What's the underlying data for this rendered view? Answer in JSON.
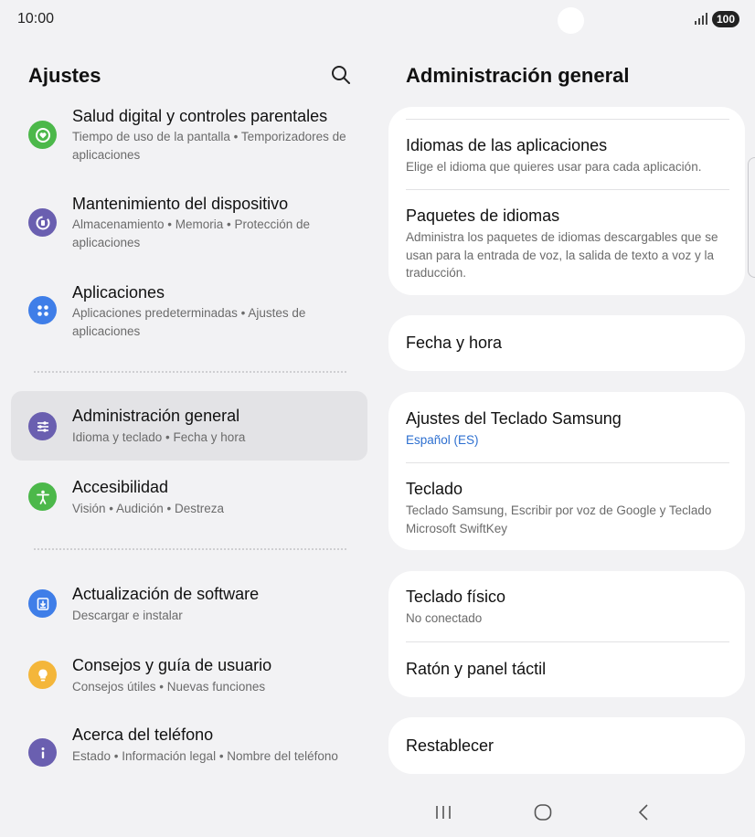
{
  "status_bar": {
    "time": "10:00",
    "battery": "100"
  },
  "left": {
    "title": "Ajustes",
    "items": [
      {
        "title": "Salud digital y controles parentales",
        "subtitle": "Tiempo de uso de la pantalla  •  Temporizadores de aplicaciones",
        "icon": "heart-icon",
        "color": "#4cb84a"
      },
      {
        "title": "Mantenimiento del dispositivo",
        "subtitle": "Almacenamiento  •  Memoria  •  Protección de aplicaciones",
        "icon": "device-care-icon",
        "color": "#6a5fb0"
      },
      {
        "title": "Aplicaciones",
        "subtitle": "Aplicaciones predeterminadas  •  Ajustes de aplicaciones",
        "icon": "apps-icon",
        "color": "#3f7ee8"
      },
      {
        "title": "Administración general",
        "subtitle": "Idioma y teclado  •  Fecha y hora",
        "icon": "sliders-icon",
        "color": "#6a5fb0"
      },
      {
        "title": "Accesibilidad",
        "subtitle": "Visión  •  Audición  •  Destreza",
        "icon": "accessibility-icon",
        "color": "#4cb84a"
      },
      {
        "title": "Actualización de software",
        "subtitle": "Descargar e instalar",
        "icon": "download-icon",
        "color": "#3f7ee8"
      },
      {
        "title": "Consejos y guía de usuario",
        "subtitle": "Consejos útiles  •  Nuevas funciones",
        "icon": "lightbulb-icon",
        "color": "#f4b63a"
      },
      {
        "title": "Acerca del teléfono",
        "subtitle": "Estado  •  Información legal  •  Nombre del teléfono",
        "icon": "info-icon",
        "color": "#6a5fb0"
      }
    ]
  },
  "right": {
    "title": "Administración general",
    "items": [
      {
        "title": "Idiomas de las aplicaciones",
        "subtitle": "Elige el idioma que quieres usar para cada aplicación."
      },
      {
        "title": "Paquetes de idiomas",
        "subtitle": "Administra los paquetes de idiomas descargables que se usan para la entrada de voz, la salida de texto a voz y la traducción."
      },
      {
        "title": "Fecha y hora"
      },
      {
        "title": "Ajustes del Teclado Samsung",
        "subtitle": "Español (ES)"
      },
      {
        "title": "Teclado",
        "subtitle": "Teclado Samsung, Escribir por voz de Google y Teclado Microsoft SwiftKey"
      },
      {
        "title": "Teclado físico",
        "subtitle": "No conectado"
      },
      {
        "title": "Ratón y panel táctil"
      },
      {
        "title": "Restablecer"
      }
    ]
  },
  "nav": {
    "recents": "recents-icon",
    "home": "home-icon",
    "back": "back-icon"
  },
  "colors": {
    "accent_blue": "#2d6fd0",
    "selected_bg": "#e3e3e6",
    "background": "#f2f2f4"
  }
}
